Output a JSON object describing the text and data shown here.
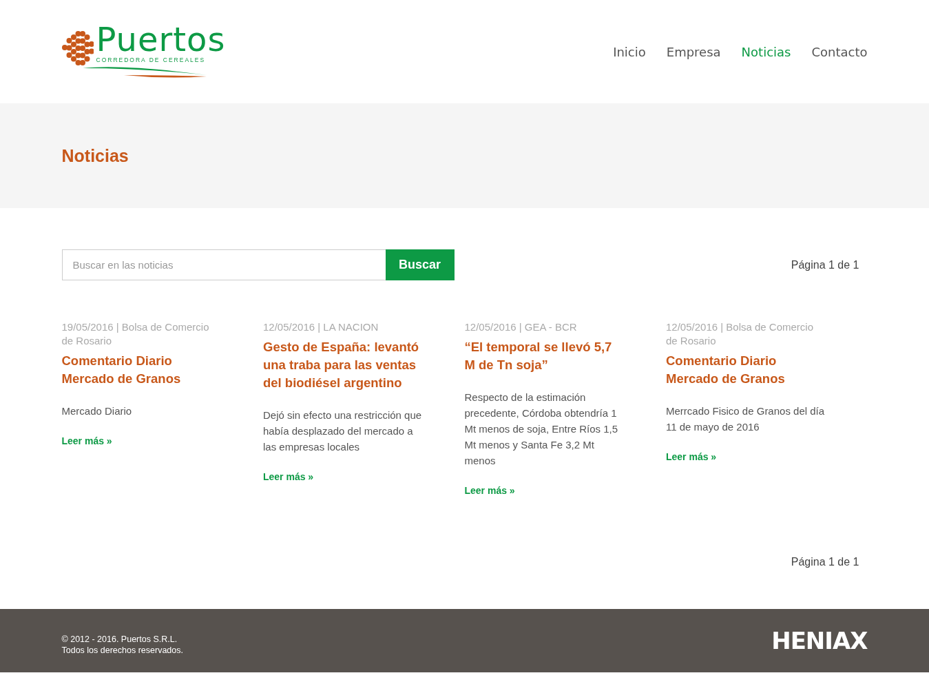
{
  "logo": {
    "name": "Puertos",
    "tagline": "CORREDORA DE CEREALES"
  },
  "nav": [
    {
      "label": "Inicio",
      "selected": false
    },
    {
      "label": "Empresa",
      "selected": false
    },
    {
      "label": "Noticias",
      "selected": true
    },
    {
      "label": "Contacto",
      "selected": false
    }
  ],
  "page_title": "Noticias",
  "search": {
    "placeholder": "Buscar en las noticias",
    "button": "Buscar"
  },
  "pagination_top": "Página 1 de 1",
  "articles": [
    {
      "meta": "19/05/2016 | Bolsa de Comercio de Rosario",
      "title": "Comentario Diario Mercado de Granos",
      "summary": "Mercado Diario",
      "link": "Leer más »"
    },
    {
      "meta": "12/05/2016 | LA NACION",
      "title": "Gesto de España: levantó una traba para las ventas del biodiésel argentino",
      "summary": "Dejó sin efecto una restricción que había desplazado del mercado a las empresas locales",
      "link": "Leer más »"
    },
    {
      "meta": "12/05/2016 | GEA - BCR",
      "title": "“El temporal se llevó 5,7 M de Tn soja”",
      "summary": "Respecto de la estimación precedente, Córdoba obtendría 1 Mt menos de soja, Entre Ríos 1,5 Mt menos y Santa Fe 3,2 Mt menos",
      "link": "Leer más »"
    },
    {
      "meta": "12/05/2016 | Bolsa de Comercio de Rosario",
      "title": "Comentario Diario Mercado de Granos",
      "summary": "Merrcado Fisico de Granos del día 11 de mayo de 2016",
      "link": "Leer más »"
    }
  ],
  "pagination_bottom": "Página 1 de 1",
  "footer": {
    "copyright": "© 2012 - 2016. Puertos S.R.L.",
    "rights": "Todos los derechos reservados.",
    "brand": "HENIAX"
  }
}
